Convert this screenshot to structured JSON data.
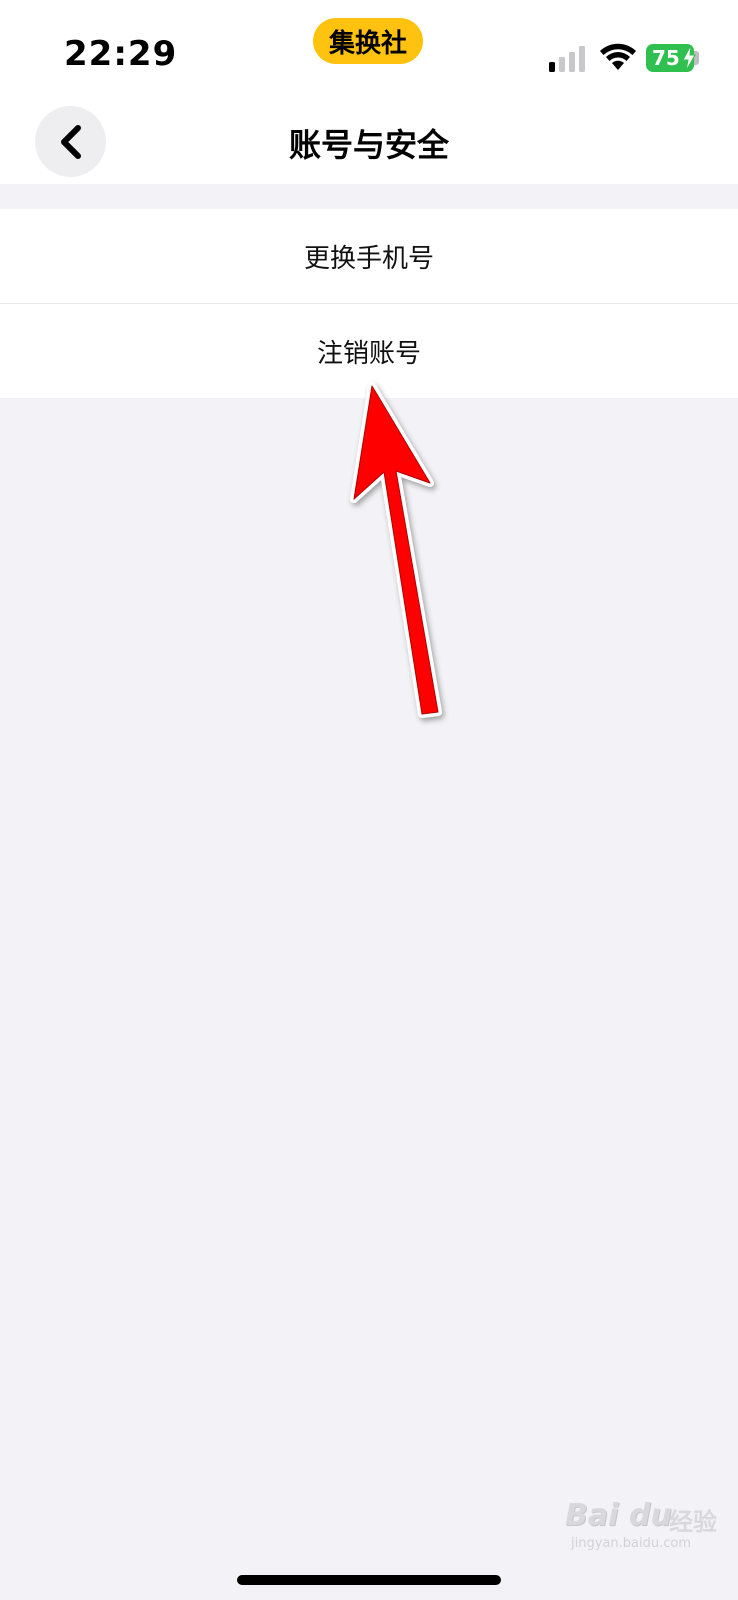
{
  "status_bar": {
    "time": "22:29",
    "app_badge": "集换社",
    "battery": "75",
    "battery_color": "#30c04f"
  },
  "nav": {
    "title": "账号与安全",
    "back_icon": "chevron-left-icon"
  },
  "menu": {
    "items": [
      {
        "label": "更换手机号"
      },
      {
        "label": "注销账号"
      }
    ]
  },
  "annotation": {
    "arrow_color": "#ff0000",
    "arrow_icon": "red-arrow-pointer"
  },
  "watermark": {
    "brand": "Bai du",
    "product": "经验",
    "url": "jingyan.baidu.com"
  },
  "colors": {
    "background": "#f3f3f7",
    "surface": "#ffffff",
    "accent_yellow": "#ffc20e"
  }
}
